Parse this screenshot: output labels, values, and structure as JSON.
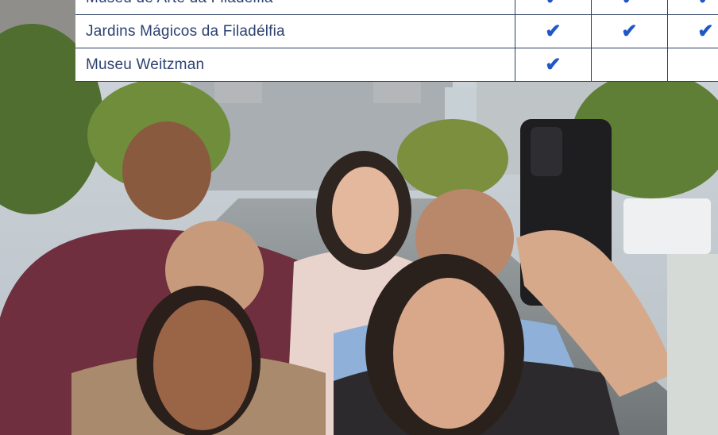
{
  "attractions_table": {
    "check_glyph": "✔",
    "rows": [
      {
        "name": "Museu de Arte da Filadélfia",
        "marks": [
          "✔",
          "✔",
          "✔"
        ]
      },
      {
        "name": "Jardins Mágicos da Filadélfia",
        "marks": [
          "✔",
          "✔",
          "✔"
        ]
      },
      {
        "name": "Museu Weitzman",
        "marks": [
          "✔",
          "",
          ""
        ]
      }
    ]
  },
  "colors": {
    "table_text": "#2c4270",
    "check": "#1f57c8",
    "border": "#2a3f64"
  }
}
